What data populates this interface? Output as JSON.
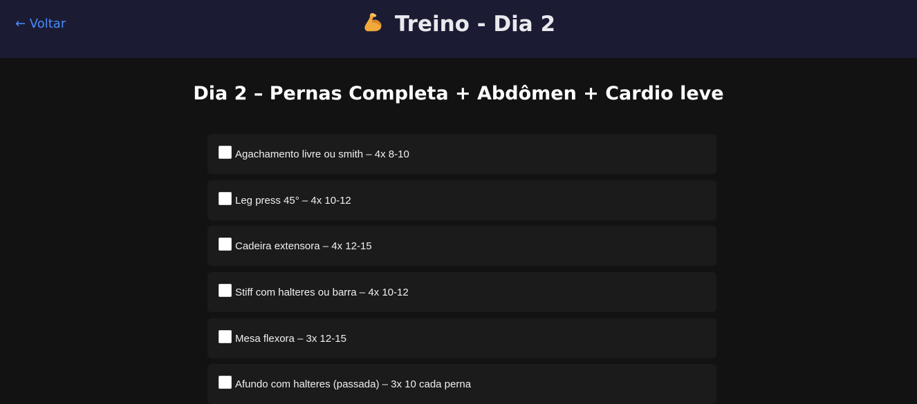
{
  "header": {
    "back_label": "← Voltar",
    "title": "Treino - Dia 2",
    "title_icon": "flexed-biceps-icon"
  },
  "main": {
    "day_title": "Dia 2 – Pernas Completa + Abdômen + Cardio leve",
    "exercises": [
      {
        "label": "Agachamento livre ou smith – 4x 8-10",
        "checked": false
      },
      {
        "label": "Leg press 45° – 4x 10-12",
        "checked": false
      },
      {
        "label": "Cadeira extensora – 4x 12-15",
        "checked": false
      },
      {
        "label": "Stiff com halteres ou barra – 4x 10-12",
        "checked": false
      },
      {
        "label": "Mesa flexora – 3x 12-15",
        "checked": false
      },
      {
        "label": "Afundo com halteres (passada) – 3x 10 cada perna",
        "checked": false
      }
    ]
  },
  "colors": {
    "header_bg": "#1b1c33",
    "page_bg": "#121212",
    "card_bg": "#1b1b1b",
    "link": "#4a8cff"
  }
}
